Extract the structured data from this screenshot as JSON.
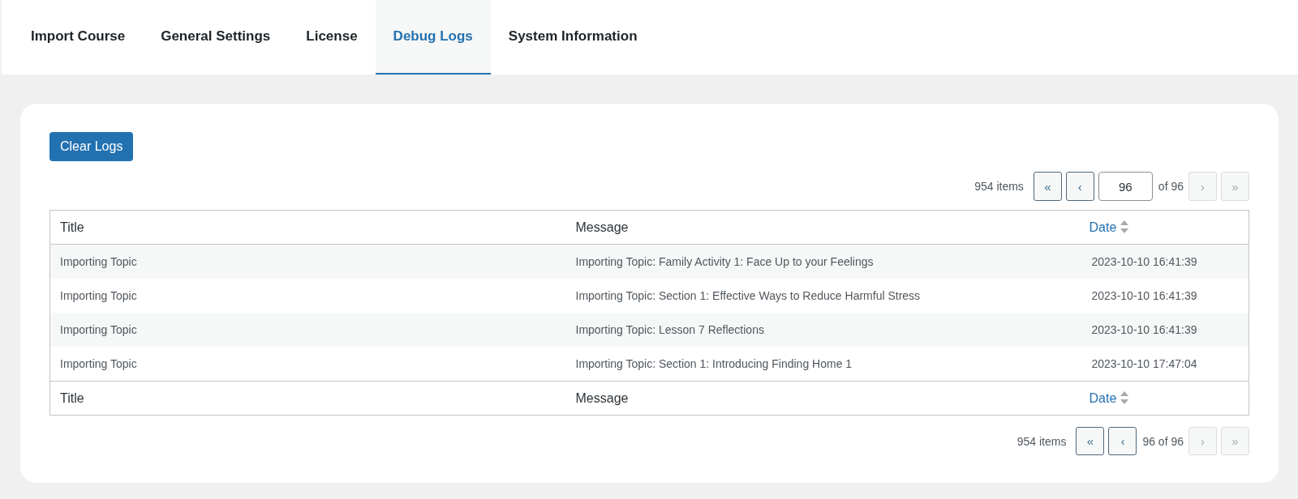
{
  "tabs": [
    {
      "label": "Import Course",
      "selected": false
    },
    {
      "label": "General Settings",
      "selected": false
    },
    {
      "label": "License",
      "selected": false
    },
    {
      "label": "Debug Logs",
      "selected": true
    },
    {
      "label": "System Information",
      "selected": false
    }
  ],
  "clear_button": {
    "label": "Clear Logs"
  },
  "pagination_top": {
    "count": "954 items",
    "back_buttons": [
      {
        "label": "«",
        "disabled": false
      },
      {
        "label": "‹",
        "disabled": false
      }
    ],
    "page_input": "96",
    "total": "of 96",
    "forward_buttons": [
      {
        "label": "›",
        "disabled": true
      },
      {
        "label": "»",
        "disabled": true
      }
    ]
  },
  "table": {
    "header": [
      {
        "label": "Title",
        "sortable": false
      },
      {
        "label": "Message",
        "sortable": false
      },
      {
        "label": "Date",
        "sortable": true
      }
    ],
    "rows": [
      {
        "title": "Importing Topic",
        "message": "Importing Topic: Family Activity 1: Face Up to your Feelings",
        "date": "2023-10-10 16:41:39"
      },
      {
        "title": "Importing Topic",
        "message": "Importing Topic: Section 1: Effective Ways to Reduce Harmful Stress",
        "date": "2023-10-10 16:41:39"
      },
      {
        "title": "Importing Topic",
        "message": "Importing Topic: Lesson 7 Reflections",
        "date": "2023-10-10 16:41:39"
      },
      {
        "title": "Importing Topic",
        "message": "Importing Topic: Section 1: Introducing Finding Home 1",
        "date": "2023-10-10 17:47:04"
      }
    ],
    "footer": [
      {
        "label": "Title",
        "sortable": false
      },
      {
        "label": "Message",
        "sortable": false
      },
      {
        "label": "Date",
        "sortable": true
      }
    ]
  },
  "pagination_bottom": {
    "count": "954 items",
    "back_buttons": [
      {
        "label": "«",
        "disabled": false
      },
      {
        "label": "‹",
        "disabled": false
      }
    ],
    "position": "96 of 96",
    "forward_buttons": [
      {
        "label": "›",
        "disabled": true
      },
      {
        "label": "»",
        "disabled": true
      }
    ]
  }
}
